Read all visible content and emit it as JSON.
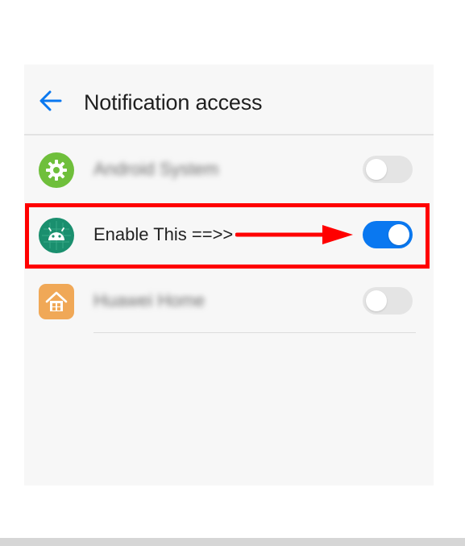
{
  "header": {
    "title": "Notification access",
    "back_icon": "arrow-left-icon"
  },
  "apps": [
    {
      "label": "Android System",
      "label_blurred": true,
      "icon": "gear-icon",
      "icon_color": "#6fbf3b",
      "enabled": false
    },
    {
      "label": "Enable This ==>>",
      "label_blurred": false,
      "icon": "android-icon",
      "icon_color": "#1a8f6e",
      "enabled": true
    },
    {
      "label": "Huawei Home",
      "label_blurred": true,
      "icon": "home-icon",
      "icon_color": "#f0a857",
      "enabled": false
    }
  ],
  "annotation": {
    "highlight_color": "#ff0000",
    "arrow_icon": "arrow-right-icon"
  },
  "colors": {
    "accent": "#0a78f0",
    "toggle_off": "#e4e4e4"
  }
}
